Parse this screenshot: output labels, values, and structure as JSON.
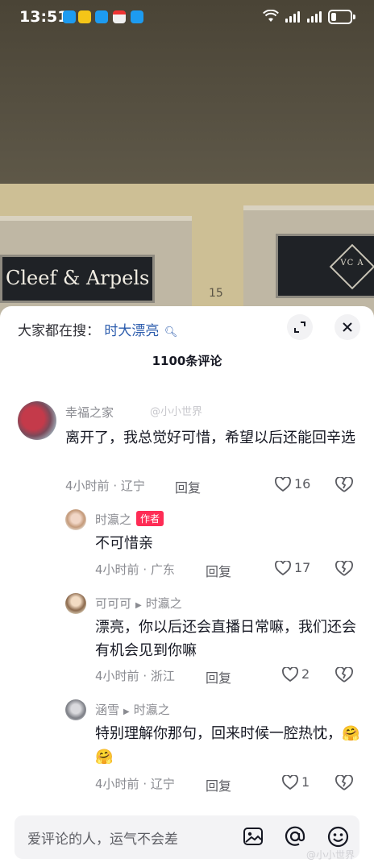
{
  "status_bar": {
    "time": "13:51",
    "notification_icons": [
      "cloud-icon",
      "app-icon",
      "message-icon",
      "red-app-icon",
      "cloud-icon"
    ],
    "notification_colors": [
      "#1d9bf0",
      "#f5c518",
      "#1d9bf0",
      "#f0f0f0",
      "#1d9bf0"
    ]
  },
  "video": {
    "sign_left_text": "Cleef & Arpels",
    "sign_right_text": "VC A",
    "house_number": "15"
  },
  "sheet": {
    "search_prefix": "大家都在搜：",
    "search_term": "时大漂亮",
    "title": "1100条评论"
  },
  "comments": [
    {
      "user": "幸福之家",
      "text": "离开了，我总觉好可惜，希望以后还能回辛选",
      "time": "4小时前",
      "location": "辽宁",
      "reply_label": "回复",
      "likes": "16"
    },
    {
      "user": "时瀛之",
      "author_tag": "作者",
      "text": "不可惜亲",
      "time": "4小时前",
      "location": "广东",
      "reply_label": "回复",
      "likes": "17"
    },
    {
      "user": "可可可",
      "reply_to": "时瀛之",
      "text": "漂亮，你以后还会直播日常嘛，我们还会有机会见到你嘛",
      "time": "4小时前",
      "location": "浙江",
      "reply_label": "回复",
      "likes": "2"
    },
    {
      "user": "涵雪",
      "reply_to": "时瀛之",
      "text": "特别理解你那句，回来时候一腔热忱，",
      "emoji": "🤗🤗",
      "time": "4小时前",
      "location": "辽宁",
      "reply_label": "回复",
      "likes": "1"
    }
  ],
  "input": {
    "placeholder": "爱评论的人，运气不会差"
  },
  "watermark": "@小小世界"
}
